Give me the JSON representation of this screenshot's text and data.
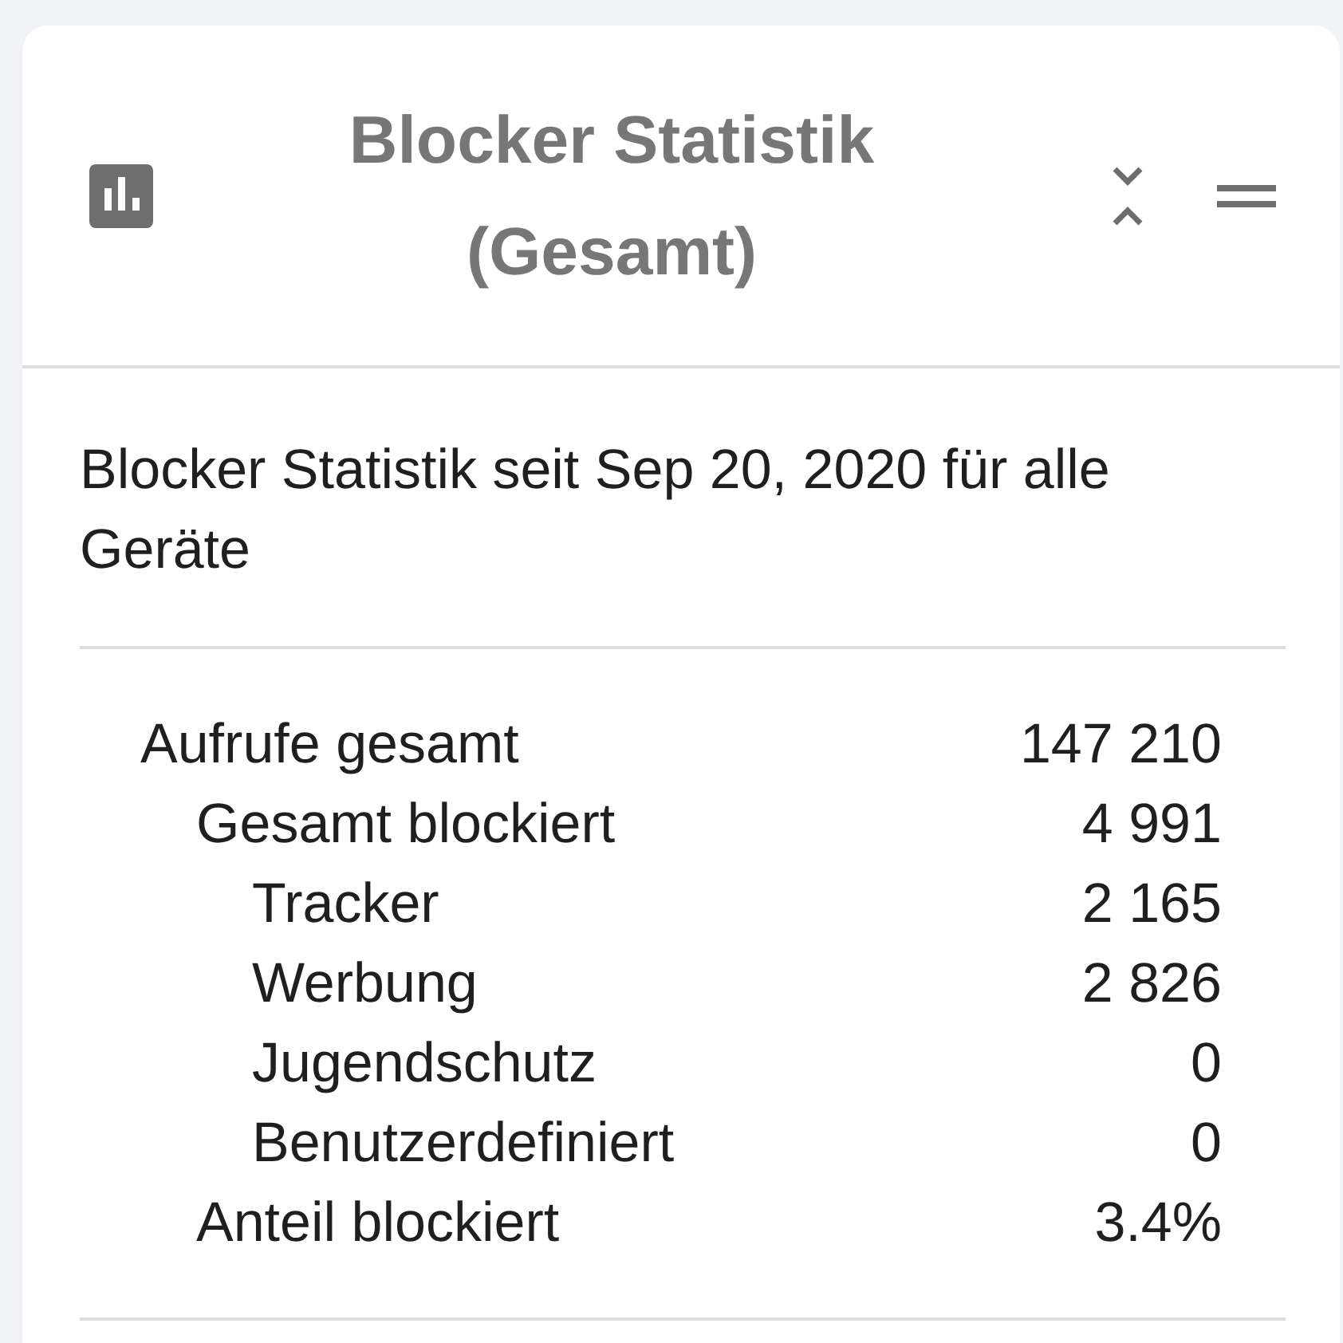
{
  "card": {
    "header": {
      "title": "Blocker Statistik (Gesamt)"
    },
    "description": "Blocker Statistik seit Sep 20, 2020 für alle Geräte",
    "stats": [
      {
        "label": "Aufrufe gesamt",
        "value": "147 210",
        "children": [
          {
            "label": "Gesamt blockiert",
            "value": "4 991",
            "children": [
              {
                "label": "Tracker",
                "value": "2 165"
              },
              {
                "label": "Werbung",
                "value": "2 826"
              },
              {
                "label": "Jugendschutz",
                "value": "0"
              },
              {
                "label": "Benutzerdefiniert",
                "value": "0"
              }
            ]
          },
          {
            "label": "Anteil blockiert",
            "value": "3.4%"
          }
        ]
      }
    ]
  }
}
